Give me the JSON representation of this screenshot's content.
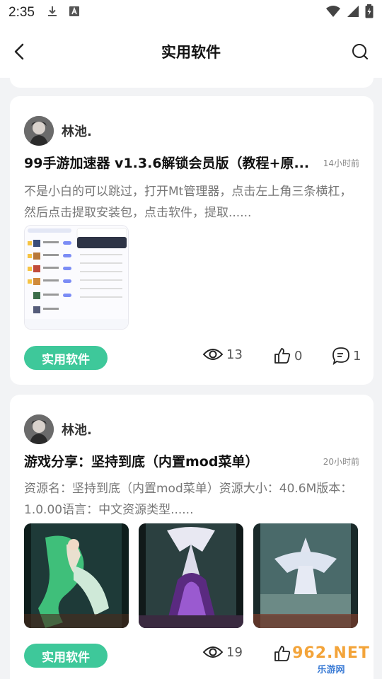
{
  "status_bar": {
    "time": "2:35",
    "icons": [
      "download-icon",
      "font-notification-icon",
      "wifi-icon",
      "signal-icon",
      "battery-charging-icon"
    ]
  },
  "header": {
    "title": "实用软件",
    "back_icon": "chevron-left-icon",
    "search_icon": "search-icon"
  },
  "posts": [
    {
      "author": "林池.",
      "title": "99手游加速器 v1.3.6解锁会员版（教程+原...",
      "time": "14小时前",
      "excerpt": "不是小白的可以跳过，打开Mt管理器，点击左上角三条横杠，然后点击提取安装包，点击软件，提取......",
      "tag": "实用软件",
      "views": "13",
      "likes": "0",
      "comments": "1"
    },
    {
      "author": "林池.",
      "title": "游戏分享：坚持到底（内置mod菜单）",
      "time": "20小时前",
      "excerpt": "资源名：坚持到底（内置mod菜单）资源大小：40.6M版本：1.0.00语言：中文资源类型......",
      "tag": "实用软件",
      "views": "19",
      "likes": "",
      "comments": ""
    }
  ],
  "watermark": {
    "main": "962.NET",
    "sub": "乐游网"
  },
  "colors": {
    "tag_bg": "#3ec89a",
    "page_bg": "#f2f3f5",
    "card_bg": "#ffffff",
    "watermark_orange": "#f3a43a",
    "watermark_blue": "#3a7bd5"
  }
}
